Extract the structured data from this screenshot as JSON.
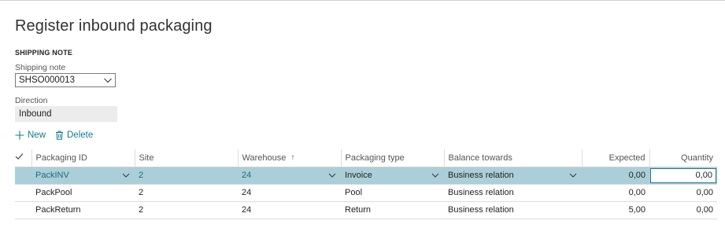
{
  "page": {
    "title": "Register inbound packaging"
  },
  "shipping_note": {
    "section_label": "SHIPPING NOTE",
    "shipping_label": "Shipping note",
    "shipping_value": "SHSO000013",
    "direction_label": "Direction",
    "direction_value": "Inbound"
  },
  "actions": {
    "new_label": "New",
    "delete_label": "Delete"
  },
  "grid": {
    "columns": {
      "packaging_id": "Packaging ID",
      "site": "Site",
      "warehouse": "Warehouse",
      "packaging_type": "Packaging type",
      "balance_towards": "Balance towards",
      "expected": "Expected",
      "quantity": "Quantity"
    },
    "rows": [
      {
        "packaging_id": "PackINV",
        "site": "2",
        "warehouse": "24",
        "packaging_type": "Invoice",
        "balance_towards": "Business relation",
        "expected": "0,00",
        "quantity": "0,00"
      },
      {
        "packaging_id": "PackPool",
        "site": "2",
        "warehouse": "24",
        "packaging_type": "Pool",
        "balance_towards": "Business relation",
        "expected": "0,00",
        "quantity": "0,00"
      },
      {
        "packaging_id": "PackReturn",
        "site": "2",
        "warehouse": "24",
        "packaging_type": "Return",
        "balance_towards": "Business relation",
        "expected": "5,00",
        "quantity": "0,00"
      }
    ]
  },
  "colors": {
    "accent": "#117b8f",
    "selected_row": "#abcfd8"
  }
}
